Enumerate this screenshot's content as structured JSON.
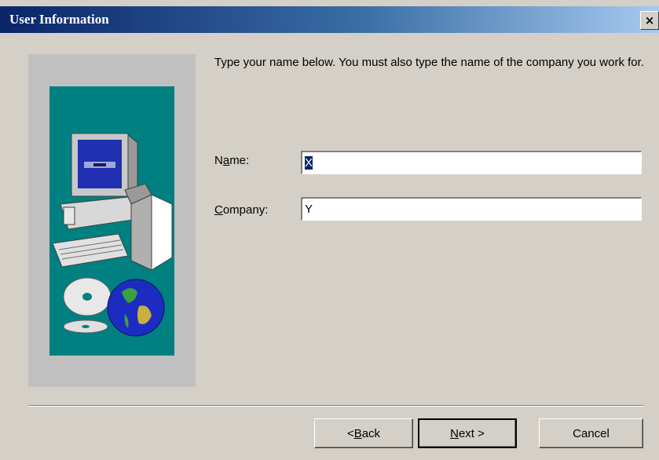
{
  "window": {
    "title": "User Information",
    "close_label": "×"
  },
  "instructions": {
    "text": "Type your name below. You must also type the name of the company you work for."
  },
  "form": {
    "name_label_prefix": "N",
    "name_label_mnemonic": "a",
    "name_label_suffix": "me:",
    "name_value_selected": "X",
    "company_label_mnemonic": "C",
    "company_label_suffix": "ompany:",
    "company_value": "Y"
  },
  "buttons": {
    "back_prefix": "< ",
    "back_mnemonic": "B",
    "back_suffix": "ack",
    "next_mnemonic": "N",
    "next_suffix": "ext >",
    "cancel_label": "Cancel"
  },
  "icons": {
    "artwork": "setup-computer-globe-illustration"
  }
}
